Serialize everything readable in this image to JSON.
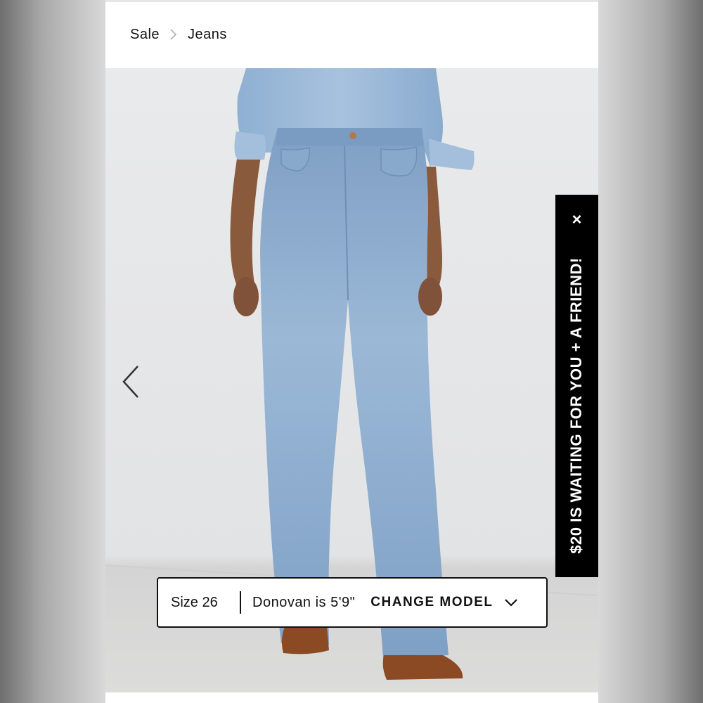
{
  "breadcrumb": {
    "items": [
      "Sale",
      "Jeans"
    ],
    "separator_icon": "chevron-right-icon"
  },
  "gallery": {
    "prev_icon": "chevron-left-icon",
    "image_subject": "model-wearing-flare-jeans"
  },
  "promo": {
    "text": "$20 IS WAITING FOR YOU + A FRIEND!",
    "close_symbol": "×",
    "background": "#000000",
    "color": "#ffffff"
  },
  "model_info": {
    "size": "Size 26",
    "model_height": "Donovan is 5'9\"",
    "change_label": "CHANGE MODEL",
    "dropdown_icon": "chevron-down-icon"
  }
}
